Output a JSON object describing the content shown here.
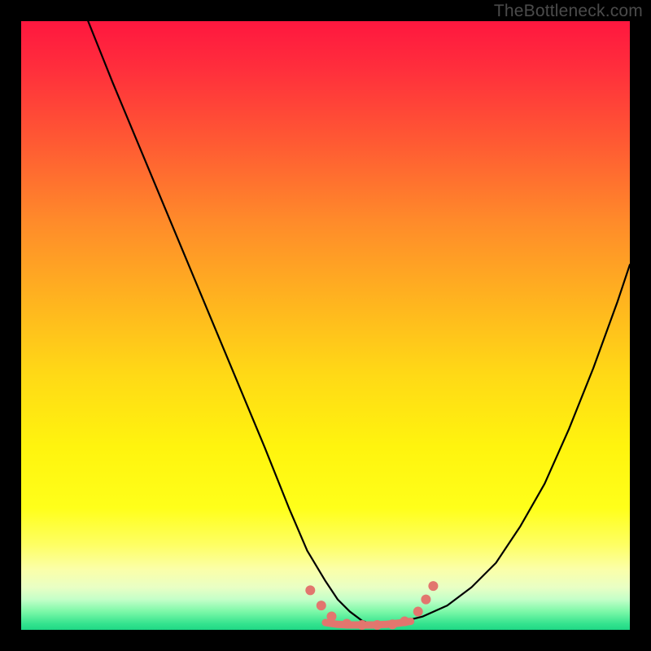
{
  "watermark": "TheBottleneck.com",
  "chart_data": {
    "type": "line",
    "title": "",
    "xlabel": "",
    "ylabel": "",
    "xlim": [
      0,
      100
    ],
    "ylim": [
      0,
      100
    ],
    "grid": false,
    "annotations": [],
    "series": [
      {
        "name": "left-curve",
        "stroke": "#000000",
        "x": [
          11,
          15,
          20,
          25,
          30,
          35,
          40,
          44,
          47,
          50,
          52,
          54,
          56,
          58
        ],
        "y": [
          100,
          90,
          78,
          66,
          54,
          42,
          30,
          20,
          13,
          8,
          5,
          3,
          1.5,
          0.8
        ]
      },
      {
        "name": "right-curve",
        "stroke": "#000000",
        "x": [
          58,
          62,
          66,
          70,
          74,
          78,
          82,
          86,
          90,
          94,
          98,
          100
        ],
        "y": [
          0.8,
          1.2,
          2.2,
          4,
          7,
          11,
          17,
          24,
          33,
          43,
          54,
          60
        ]
      },
      {
        "name": "flat-band",
        "stroke": "#e2766e",
        "x": [
          50,
          52,
          54,
          56,
          58,
          60,
          62,
          64
        ],
        "y": [
          1.2,
          0.9,
          0.8,
          0.8,
          0.8,
          0.9,
          1.1,
          1.4
        ]
      }
    ],
    "markers": [
      {
        "x": 47.5,
        "y": 6.5,
        "r": 6,
        "fill": "#e2766e"
      },
      {
        "x": 49.3,
        "y": 4.0,
        "r": 6,
        "fill": "#e2766e"
      },
      {
        "x": 51.0,
        "y": 2.2,
        "r": 6,
        "fill": "#e2766e"
      },
      {
        "x": 53.5,
        "y": 1.0,
        "r": 6,
        "fill": "#e2766e"
      },
      {
        "x": 56.0,
        "y": 0.8,
        "r": 6,
        "fill": "#e2766e"
      },
      {
        "x": 58.5,
        "y": 0.8,
        "r": 6,
        "fill": "#e2766e"
      },
      {
        "x": 61.0,
        "y": 0.9,
        "r": 6,
        "fill": "#e2766e"
      },
      {
        "x": 63.0,
        "y": 1.4,
        "r": 6,
        "fill": "#e2766e"
      },
      {
        "x": 65.2,
        "y": 3.0,
        "r": 6,
        "fill": "#e2766e"
      },
      {
        "x": 66.5,
        "y": 5.0,
        "r": 6,
        "fill": "#e2766e"
      },
      {
        "x": 67.7,
        "y": 7.2,
        "r": 6,
        "fill": "#e2766e"
      }
    ],
    "gradient_stops": [
      {
        "pct": 0,
        "color": "#ff173f"
      },
      {
        "pct": 20,
        "color": "#ff5a33"
      },
      {
        "pct": 46,
        "color": "#ffb41f"
      },
      {
        "pct": 70,
        "color": "#fff40e"
      },
      {
        "pct": 90,
        "color": "#fbffa8"
      },
      {
        "pct": 100,
        "color": "#1fd885"
      }
    ]
  }
}
